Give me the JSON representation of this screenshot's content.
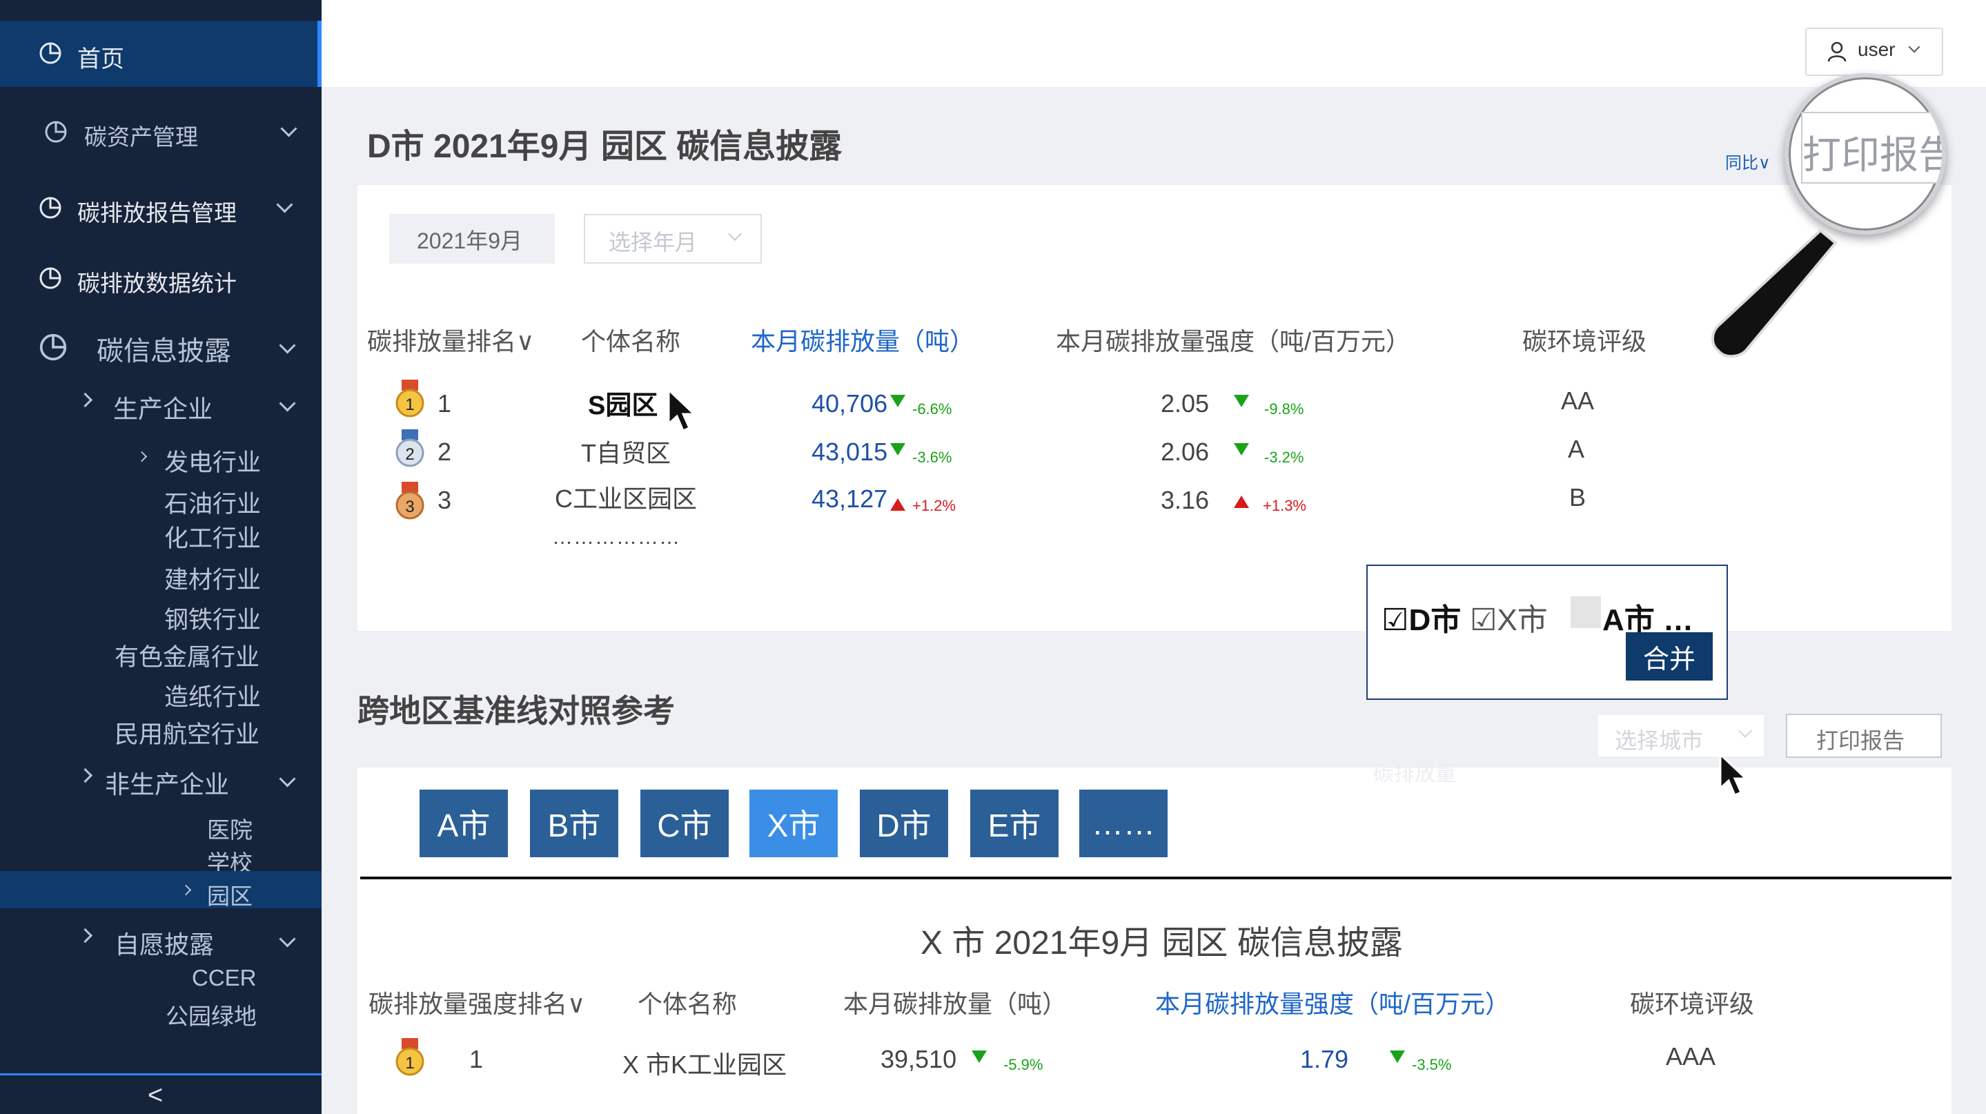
{
  "sidebar": {
    "home": "首页",
    "items": [
      {
        "label": "碳资产管理"
      },
      {
        "label": "碳排放报告管理"
      },
      {
        "label": "碳排放数据统计"
      },
      {
        "label": "碳信息披露"
      }
    ],
    "disclosure": {
      "producer": "生产企业",
      "industries": [
        "发电行业",
        "石油行业",
        "化工行业",
        "建材行业",
        "钢铁行业",
        "有色金属行业",
        "造纸行业",
        "民用航空行业"
      ],
      "non_producer": "非生产企业",
      "non_items": [
        "医院",
        "学校",
        "园区"
      ],
      "voluntary": "自愿披露",
      "vol_items": [
        "CCER",
        "公园绿地"
      ]
    },
    "collapse_glyph": "<"
  },
  "header": {
    "user": "user"
  },
  "section1": {
    "title": "D市 2021年9月 园区 碳信息披露",
    "yoy": "同比∨",
    "print": "打印报告",
    "date_value": "2021年9月",
    "month_placeholder": "选择年月",
    "columns": [
      "碳排放量排名∨",
      "个体名称",
      "本月碳排放量（吨）",
      "本月碳排放量强度（吨/百万元）",
      "碳环境评级"
    ],
    "rows": [
      {
        "rank": "1",
        "name": "S园区",
        "emission": "40,706",
        "e_pct": "-6.6%",
        "intensity": "2.05",
        "i_pct": "-9.8%",
        "grade": "AA",
        "e_dir": "down",
        "i_dir": "down"
      },
      {
        "rank": "2",
        "name": "T自贸区",
        "emission": "43,015",
        "e_pct": "-3.6%",
        "intensity": "2.06",
        "i_pct": "-3.2%",
        "grade": "A",
        "e_dir": "down",
        "i_dir": "down"
      },
      {
        "rank": "3",
        "name": "C工业区园区",
        "emission": "43,127",
        "e_pct": "+1.2%",
        "intensity": "3.16",
        "i_pct": "+1.3%",
        "grade": "B",
        "e_dir": "up",
        "i_dir": "up"
      }
    ],
    "more": "………………"
  },
  "merge_popup": {
    "d_city": "☑D市",
    "x_city": "☑X市",
    "a_city": "A市 …",
    "merge": "合并"
  },
  "section2": {
    "title": "跨地区基准线对照参考",
    "city_placeholder": "选择城市",
    "print": "打印报告",
    "faded": "碳排放量",
    "cities": [
      "A市",
      "B市",
      "C市",
      "X市",
      "D市",
      "E市",
      "……"
    ],
    "sub_title": "X 市 2021年9月 园区 碳信息披露",
    "columns": [
      "碳排放量强度排名∨",
      "个体名称",
      "本月碳排放量（吨）",
      "本月碳排放量强度（吨/百万元）",
      "碳环境评级"
    ],
    "row": {
      "rank": "1",
      "name": "X 市K工业园区",
      "emission": "39,510",
      "e_pct": "-5.9%",
      "intensity": "1.79",
      "i_pct": "-3.5%",
      "grade": "AAA"
    }
  },
  "colors": {
    "sidebar": "#16243b",
    "active": "#0e3a6c",
    "accent": "#2e86ff",
    "city_btn": "#2b5f97",
    "city_btn_active": "#3a8ee6",
    "down": "#1aa31a",
    "up": "#d81b1b"
  }
}
